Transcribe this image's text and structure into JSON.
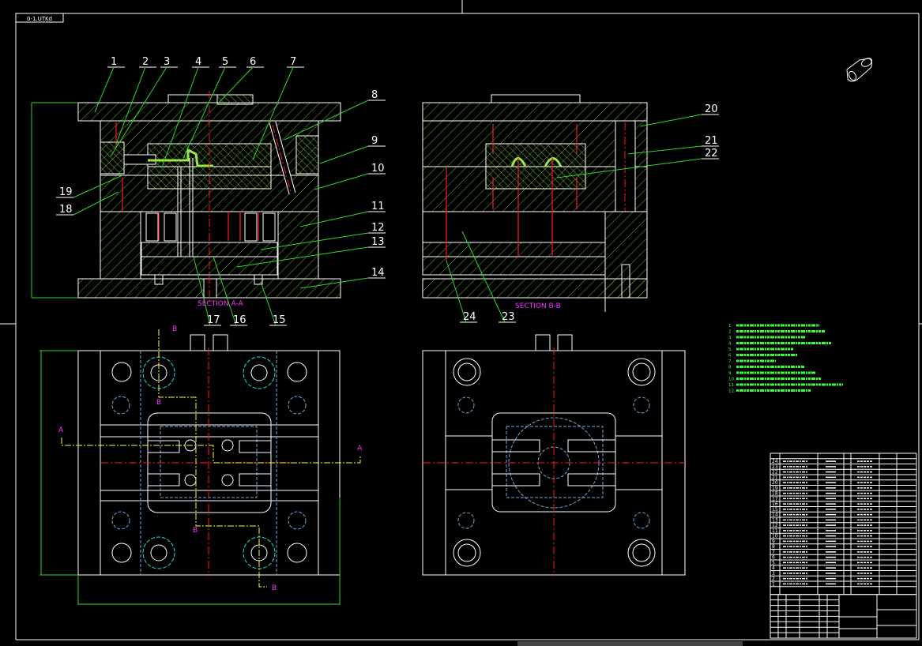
{
  "drawing": {
    "tag_box": "0-1.UTKd",
    "section_a_label": "SECTION A-A",
    "section_b_label": "SECTION B-B",
    "cut_a": "A",
    "cut_b": "B"
  },
  "callouts": [
    "1",
    "2",
    "3",
    "4",
    "5",
    "6",
    "7",
    "8",
    "9",
    "10",
    "11",
    "12",
    "13",
    "14",
    "15",
    "16",
    "17",
    "18",
    "19",
    "20",
    "21",
    "22",
    "23",
    "24"
  ],
  "notes": {
    "numbers": [
      "1.",
      "2.",
      "3.",
      "4.",
      "5.",
      "6.",
      "7.",
      "8.",
      "9.",
      "10.",
      "11.",
      "12."
    ]
  },
  "parts_list": {
    "row_numbers": [
      "24",
      "23",
      "22",
      "21",
      "20",
      "19",
      "18",
      "17",
      "16",
      "15",
      "14",
      "13",
      "12",
      "11",
      "10",
      "9",
      "8",
      "7",
      "6",
      "5",
      "4",
      "3",
      "2",
      "1"
    ]
  },
  "colors": {
    "background": "#000000",
    "outline": "#ffffff",
    "hatch": "#7fe03a",
    "centerline": "#ff1a1a",
    "leader": "#2bd92b",
    "section_line": "#ffff33",
    "section_text": "#ff33ff",
    "hidden": "#6fa8dc"
  }
}
